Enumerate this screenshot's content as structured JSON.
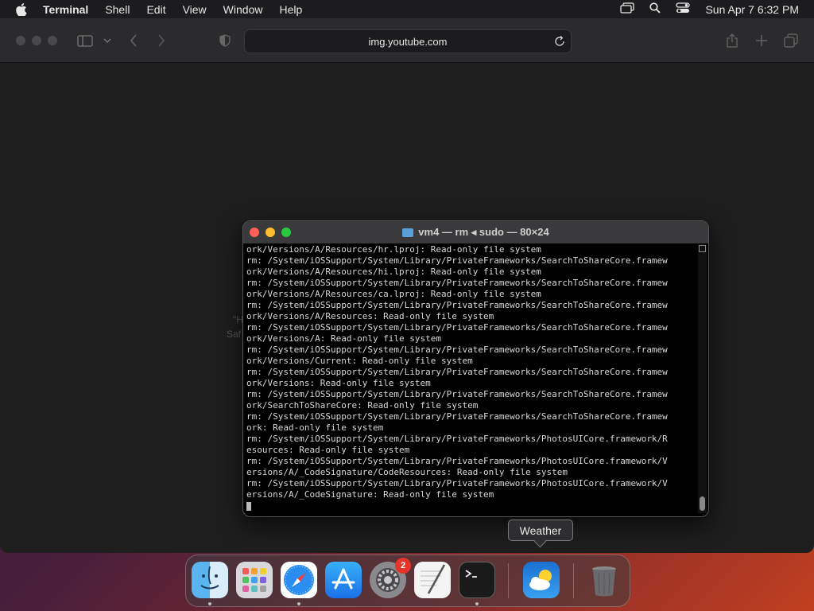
{
  "menubar": {
    "app_name": "Terminal",
    "items": [
      "Shell",
      "Edit",
      "View",
      "Window",
      "Help"
    ],
    "clock": "Sun Apr 7  6:32 PM"
  },
  "safari": {
    "address": "img.youtube.com",
    "faint_lines": [
      "\"H",
      "Saf"
    ]
  },
  "terminal": {
    "title": "vm4 — rm ◂ sudo — 80×24",
    "lines": [
      "ork/Versions/A/Resources/hr.lproj: Read-only file system",
      "rm: /System/iOSSupport/System/Library/PrivateFrameworks/SearchToShareCore.framew",
      "ork/Versions/A/Resources/hi.lproj: Read-only file system",
      "rm: /System/iOSSupport/System/Library/PrivateFrameworks/SearchToShareCore.framew",
      "ork/Versions/A/Resources/ca.lproj: Read-only file system",
      "rm: /System/iOSSupport/System/Library/PrivateFrameworks/SearchToShareCore.framew",
      "ork/Versions/A/Resources: Read-only file system",
      "rm: /System/iOSSupport/System/Library/PrivateFrameworks/SearchToShareCore.framew",
      "ork/Versions/A: Read-only file system",
      "rm: /System/iOSSupport/System/Library/PrivateFrameworks/SearchToShareCore.framew",
      "ork/Versions/Current: Read-only file system",
      "rm: /System/iOSSupport/System/Library/PrivateFrameworks/SearchToShareCore.framew",
      "ork/Versions: Read-only file system",
      "rm: /System/iOSSupport/System/Library/PrivateFrameworks/SearchToShareCore.framew",
      "ork/SearchToShareCore: Read-only file system",
      "rm: /System/iOSSupport/System/Library/PrivateFrameworks/SearchToShareCore.framew",
      "ork: Read-only file system",
      "rm: /System/iOSSupport/System/Library/PrivateFrameworks/PhotosUICore.framework/R",
      "esources: Read-only file system",
      "rm: /System/iOSSupport/System/Library/PrivateFrameworks/PhotosUICore.framework/V",
      "ersions/A/_CodeSignature/CodeResources: Read-only file system",
      "rm: /System/iOSSupport/System/Library/PrivateFrameworks/PhotosUICore.framework/V",
      "ersions/A/_CodeSignature: Read-only file system"
    ]
  },
  "tooltip": {
    "label": "Weather"
  },
  "dock": {
    "items": [
      {
        "name": "finder",
        "icon": "finder-icon",
        "running": true
      },
      {
        "name": "launchpad",
        "icon": "launchpad-icon",
        "running": false
      },
      {
        "name": "safari",
        "icon": "safari-icon",
        "running": true
      },
      {
        "name": "app-store",
        "icon": "app-store-icon",
        "running": false
      },
      {
        "name": "system-settings",
        "icon": "gear-icon",
        "running": false,
        "badge": "2"
      },
      {
        "name": "textedit",
        "icon": "textedit-icon",
        "running": false
      },
      {
        "name": "terminal",
        "icon": "terminal-icon",
        "running": true
      },
      {
        "name": "weather",
        "icon": "weather-icon",
        "running": false
      },
      {
        "name": "trash",
        "icon": "trash-icon",
        "running": false
      }
    ]
  },
  "colors": {
    "close": "#ff5f57",
    "minimize": "#febc2e",
    "zoom": "#28c840",
    "badge": "#e5352b"
  }
}
